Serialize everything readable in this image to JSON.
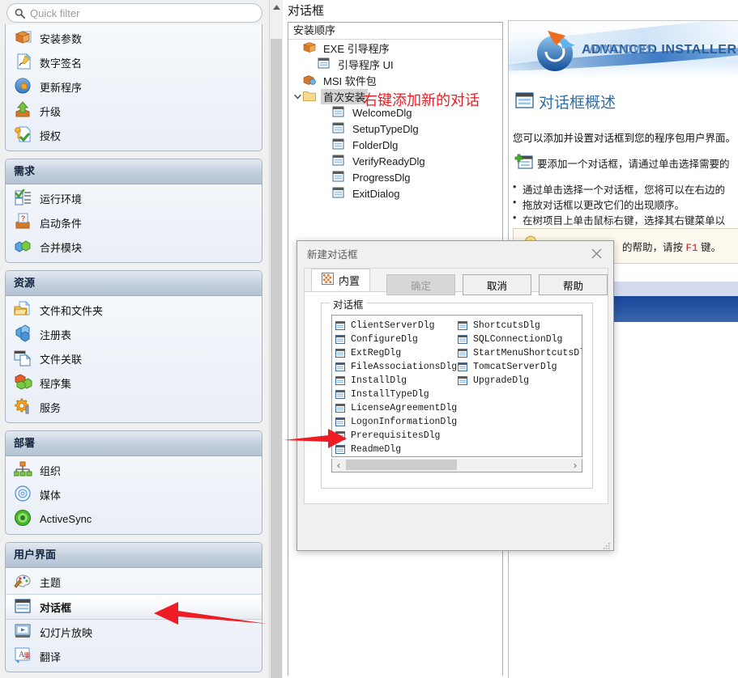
{
  "search": {
    "placeholder": "Quick filter",
    "value": "",
    "icon": "search-icon"
  },
  "sidebar": {
    "groups": [
      {
        "header": null,
        "items": [
          {
            "label": "安装参数",
            "icon": "package-icon"
          },
          {
            "label": "数字签名",
            "icon": "signature-icon"
          },
          {
            "label": "更新程序",
            "icon": "updater-icon"
          },
          {
            "label": "升级",
            "icon": "upgrade-icon"
          },
          {
            "label": "授权",
            "icon": "license-key-icon"
          }
        ]
      },
      {
        "header": "需求",
        "items": [
          {
            "label": "运行环境",
            "icon": "checklist-icon"
          },
          {
            "label": "启动条件",
            "icon": "launch-condition-icon"
          },
          {
            "label": "合并模块",
            "icon": "merge-module-icon"
          }
        ]
      },
      {
        "header": "资源",
        "items": [
          {
            "label": "文件和文件夹",
            "icon": "folder-icon"
          },
          {
            "label": "注册表",
            "icon": "registry-icon"
          },
          {
            "label": "文件关联",
            "icon": "file-association-icon"
          },
          {
            "label": "程序集",
            "icon": "assembly-icon"
          },
          {
            "label": "服务",
            "icon": "service-gear-icon"
          }
        ]
      },
      {
        "header": "部署",
        "items": [
          {
            "label": "组织",
            "icon": "organization-icon"
          },
          {
            "label": "媒体",
            "icon": "media-disc-icon"
          },
          {
            "label": "ActiveSync",
            "icon": "activesync-icon"
          }
        ]
      },
      {
        "header": "用户界面",
        "items": [
          {
            "label": "主题",
            "icon": "theme-palette-icon"
          },
          {
            "label": "对话框",
            "icon": "dialog-icon",
            "selected": true
          },
          {
            "label": "幻灯片放映",
            "icon": "slideshow-icon"
          },
          {
            "label": "翻译",
            "icon": "translation-icon"
          }
        ]
      }
    ]
  },
  "tree": {
    "title": "对话框",
    "column_header": "安装顺序",
    "nodes": [
      {
        "label": "EXE 引导程序",
        "indent": 0,
        "icon": "bootstrapper-icon",
        "twisty": ""
      },
      {
        "label": "引导程序 UI",
        "indent": 1,
        "icon": "dialog-icon",
        "twisty": ""
      },
      {
        "label": "MSI 软件包",
        "indent": 0,
        "icon": "msi-package-icon",
        "twisty": ""
      },
      {
        "label": "首次安装",
        "indent": 0,
        "icon": "folder-icon",
        "twisty": "expanded",
        "selected": true
      },
      {
        "label": "WelcomeDlg",
        "indent": 2,
        "icon": "dialog-icon",
        "twisty": ""
      },
      {
        "label": "SetupTypeDlg",
        "indent": 2,
        "icon": "dialog-icon",
        "twisty": ""
      },
      {
        "label": "FolderDlg",
        "indent": 2,
        "icon": "dialog-icon",
        "twisty": ""
      },
      {
        "label": "VerifyReadyDlg",
        "indent": 2,
        "icon": "dialog-icon",
        "twisty": ""
      },
      {
        "label": "ProgressDlg",
        "indent": 2,
        "icon": "dialog-icon",
        "twisty": ""
      },
      {
        "label": "ExitDialog",
        "indent": 2,
        "icon": "dialog-icon",
        "twisty": ""
      }
    ]
  },
  "annotations": {
    "tree_note": "右键添加新的对话",
    "tree_note_color": "#ec1c24",
    "arrow_color": "#ee1c25"
  },
  "right_panel": {
    "brand": "ADVANCED INSTALLER",
    "brand_overlay": "WINDOWS",
    "title": "对话框概述",
    "title_color": "#2f6fa8",
    "intro": "您可以添加并设置对话框到您的程序包用户界面。",
    "tip": "要添加一个对话框，请通过单击选择需要的",
    "bullets": [
      "通过单击选择一个对话框，您将可以在右边的",
      "拖放对话框以更改它们的出现顺序。",
      "在树项目上单击鼠标右键，选择其右键菜单以"
    ],
    "help_text_before": "的帮助，请按 ",
    "help_key": "F1",
    "help_text_after": " 键。",
    "accent_blue": "#1d4c9f",
    "light_row": "#d3dcee"
  },
  "modal": {
    "title": "新建对话框",
    "close_icon": "close-icon",
    "tab": {
      "label": "内置",
      "icon": "builtin-grid-icon"
    },
    "groupbox_legend": "对话框",
    "list_column_1": [
      "ClientServerDlg",
      "ConfigureDlg",
      "ExtRegDlg",
      "FileAssociationsDlg",
      "InstallDlg",
      "InstallTypeDlg",
      "LicenseAgreementDlg",
      "LogonInformationDlg",
      "PrerequisitesDlg",
      "ReadmeDlg"
    ],
    "list_column_2": [
      "ShortcutsDlg",
      "SQLConnectionDlg",
      "StartMenuShortcutsDlg",
      "TomcatServerDlg",
      "UpgradeDlg"
    ],
    "hscroll": {
      "left_arrow": "‹",
      "right_arrow": "›"
    },
    "buttons": {
      "ok": "确定",
      "cancel": "取消",
      "help": "帮助"
    }
  }
}
